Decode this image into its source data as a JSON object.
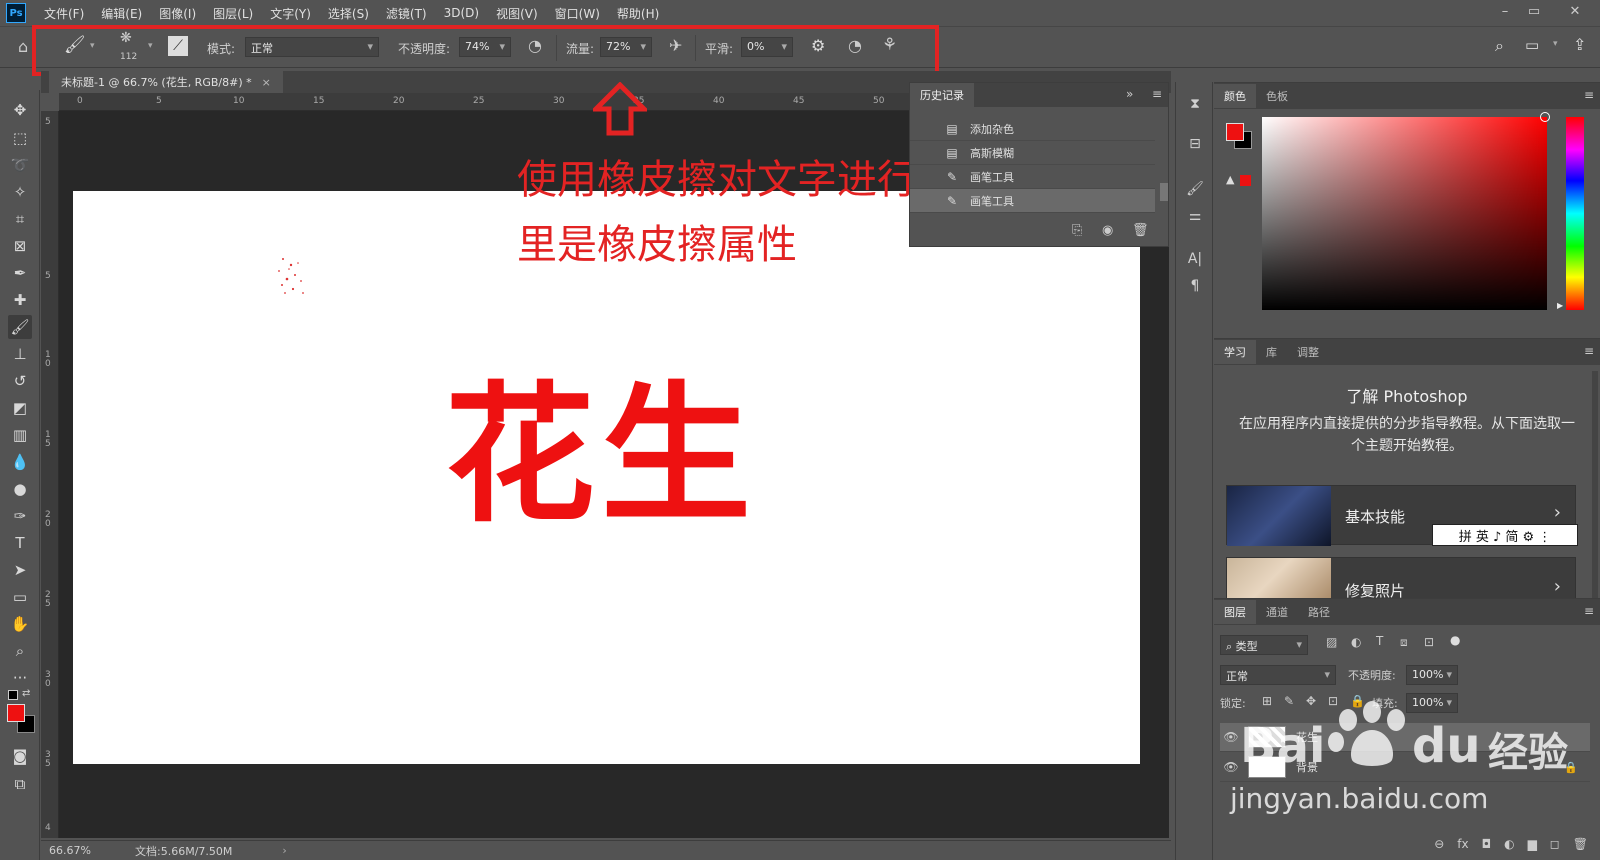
{
  "app": {
    "logo": "Ps"
  },
  "menu": [
    "文件(F)",
    "编辑(E)",
    "图像(I)",
    "图层(L)",
    "文字(Y)",
    "选择(S)",
    "滤镜(T)",
    "3D(D)",
    "视图(V)",
    "窗口(W)",
    "帮助(H)"
  ],
  "window_controls": {
    "minimize": "–",
    "restore": "▭",
    "close": "✕"
  },
  "options": {
    "brush_size": "112",
    "mode_label": "模式:",
    "mode_value": "正常",
    "opacity_label": "不透明度:",
    "opacity_value": "74%",
    "flow_label": "流量:",
    "flow_value": "72%",
    "smooth_label": "平滑:",
    "smooth_value": "0%"
  },
  "document": {
    "tab_title": "未标题-1 @ 66.7% (花生, RGB/8#) *",
    "tab_close": "×",
    "canvas_text": "花生",
    "ruler_top": [
      "0",
      "5",
      "10",
      "15",
      "20",
      "25",
      "30",
      "35",
      "40",
      "45",
      "50"
    ],
    "ruler_left": [
      "5",
      "5",
      "1 0",
      "1 5",
      "2 0",
      "2 5",
      "3 0",
      "3 5",
      "4"
    ],
    "zoom": "66.67%",
    "doc_size": "文档:5.66M/7.50M",
    "status_arrow": "›"
  },
  "annotation": {
    "line1": "使用橡皮擦对文字进行处理，这",
    "line2": "里是橡皮擦属性"
  },
  "history": {
    "tab": "历史记录",
    "expand": "»",
    "items": [
      {
        "label": "添加杂色",
        "icon": "▤"
      },
      {
        "label": "高斯模糊",
        "icon": "▤"
      },
      {
        "label": "画笔工具",
        "icon": "✎"
      },
      {
        "label": "画笔工具",
        "icon": "✎"
      }
    ]
  },
  "color_panel": {
    "tabs": [
      "颜色",
      "色板"
    ],
    "fg": "#ee1111",
    "bg": "#000000"
  },
  "learn_panel": {
    "tabs": [
      "学习",
      "库",
      "调整"
    ],
    "title": "了解 Photoshop",
    "desc": "在应用程序内直接提供的分步指导教程。从下面选取一个主题开始教程。",
    "cards": [
      {
        "label": "基本技能"
      },
      {
        "label": "修复照片"
      }
    ],
    "ime_bar": "拼 英 ♪ 简 ⚙ ⋮"
  },
  "layers_panel": {
    "tabs": [
      "图层",
      "通道",
      "路径"
    ],
    "filter": "类型",
    "blend": "正常",
    "opacity_label": "不透明度:",
    "opacity_value": "100%",
    "lock_label": "锁定:",
    "fill_label": "填充:",
    "fill_value": "100%",
    "layers": [
      {
        "name": "花生",
        "selected": true
      },
      {
        "name": "背景",
        "selected": false
      }
    ],
    "footer_icons": [
      "⊖",
      "fx",
      "◘",
      "◐",
      "▆",
      "◻",
      "🗑"
    ]
  },
  "watermark": {
    "brand": "Bai",
    "brand2": "du",
    "cn": "经验",
    "url": "jingyan.baidu.com"
  }
}
